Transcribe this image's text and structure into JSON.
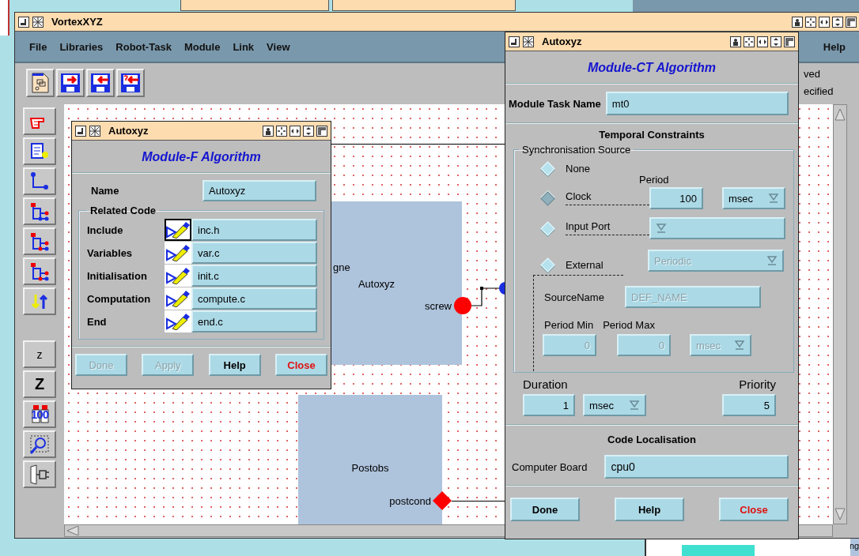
{
  "desktop": {
    "side_text": "ng"
  },
  "main_window": {
    "title": "VortexXYZ",
    "menu": [
      {
        "label": "File"
      },
      {
        "label": "Libraries"
      },
      {
        "label": "Robot-Task"
      },
      {
        "label": "Module"
      },
      {
        "label": "Link"
      },
      {
        "label": "View"
      }
    ],
    "help": "Help",
    "status_texts": [
      "ved",
      "ecified"
    ],
    "tools": [
      {
        "kind": "letter",
        "label": "z"
      },
      {
        "kind": "capital",
        "label": "Z"
      },
      {
        "kind": "binoculars",
        "label": "100"
      }
    ]
  },
  "canvas": {
    "modules": [
      {
        "name": "Autoxyz",
        "side_label": "gne",
        "port": "screw",
        "kind": "circle"
      },
      {
        "name": "Postobs",
        "port": "postcond",
        "kind": "diamond"
      }
    ]
  },
  "f_dialog": {
    "title": "Autoxyz",
    "heading": "Module-F Algorithm",
    "name_label": "Name",
    "name_value": "Autoxyz",
    "group_label": "Related Code",
    "rows": [
      {
        "label": "Include",
        "value": "inc.h",
        "selected": true
      },
      {
        "label": "Variables",
        "value": "var.c",
        "selected": false
      },
      {
        "label": "Initialisation",
        "value": "init.c",
        "selected": false
      },
      {
        "label": "Computation",
        "value": "compute.c",
        "selected": false
      },
      {
        "label": "End",
        "value": "end.c",
        "selected": false
      }
    ],
    "buttons": [
      {
        "label": "Done",
        "kind": "plain",
        "disabled": true
      },
      {
        "label": "Apply",
        "kind": "plain",
        "disabled": true
      },
      {
        "label": "Help",
        "kind": "plain",
        "disabled": false
      },
      {
        "label": "Close",
        "kind": "close",
        "disabled": false
      }
    ]
  },
  "ct_dialog": {
    "title": "Autoxyz",
    "heading": "Module-CT Algorithm",
    "task_label": "Module Task Name",
    "task_value": "mt0",
    "section": "Temporal Constraints",
    "group_label": "Synchronisation Source",
    "period_label": "Period",
    "sources": [
      {
        "label": "None",
        "selected": false
      },
      {
        "label": "Clock",
        "selected": true
      },
      {
        "label": "Input Port",
        "selected": false
      },
      {
        "label": "External",
        "selected": false
      }
    ],
    "clock_period": "100",
    "clock_unit": "msec",
    "external_mode": {
      "value": "Periodic",
      "disabled": true
    },
    "source_name_label": "SourceName",
    "source_name": {
      "value": "DEF_NAME",
      "disabled": true
    },
    "period_min_label": "Period Min",
    "period_max_label": "Period Max",
    "period_min": {
      "value": "0",
      "disabled": true
    },
    "period_max": {
      "value": "0",
      "disabled": true
    },
    "period_unit": {
      "value": "msec",
      "disabled": true
    },
    "duration_label": "Duration",
    "duration": "1",
    "duration_unit": "msec",
    "priority_label": "Priority",
    "priority": "5",
    "code_section": "Code Localisation",
    "board_label": "Computer Board",
    "board": "cpu0",
    "buttons": [
      {
        "label": "Done",
        "kind": "plain",
        "disabled": false
      },
      {
        "label": "Help",
        "kind": "plain",
        "disabled": false
      },
      {
        "label": "Close",
        "kind": "close",
        "disabled": false
      }
    ]
  }
}
